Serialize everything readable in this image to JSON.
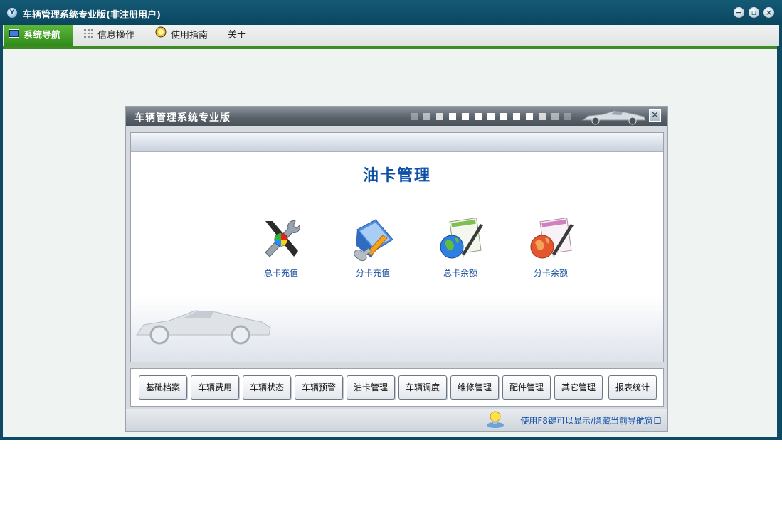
{
  "window": {
    "title": "车辆管理系统专业版(非注册用户)",
    "app_icon": "yf-logo-icon",
    "controls": [
      "minimize-icon",
      "restore-icon",
      "close-icon"
    ]
  },
  "menu": {
    "items": [
      {
        "label": "系统导航",
        "icon": "monitor-icon",
        "active": true
      },
      {
        "label": "信息操作",
        "icon": "grid-icon",
        "active": false
      },
      {
        "label": "使用指南",
        "icon": "help-circle-icon",
        "active": false
      },
      {
        "label": "关于",
        "icon": "",
        "active": false
      }
    ],
    "accent": "#3f8c23"
  },
  "dialog": {
    "title": "车辆管理系统专业版",
    "section_title": "油卡管理",
    "nav_items": [
      {
        "label": "总卡充值",
        "icon": "tools-icon"
      },
      {
        "label": "分卡充值",
        "icon": "document-edit-icon"
      },
      {
        "label": "总卡余额",
        "icon": "globe-blue-pen-icon"
      },
      {
        "label": "分卡余额",
        "icon": "globe-orange-pen-icon"
      }
    ],
    "modules": [
      "基础档案",
      "车辆费用",
      "车辆状态",
      "车辆预警",
      "油卡管理",
      "车辆调度",
      "维修管理",
      "配件管理",
      "其它管理",
      "报表统计"
    ],
    "tip": "使用F8键可以显示/隐藏当前导航窗口"
  }
}
